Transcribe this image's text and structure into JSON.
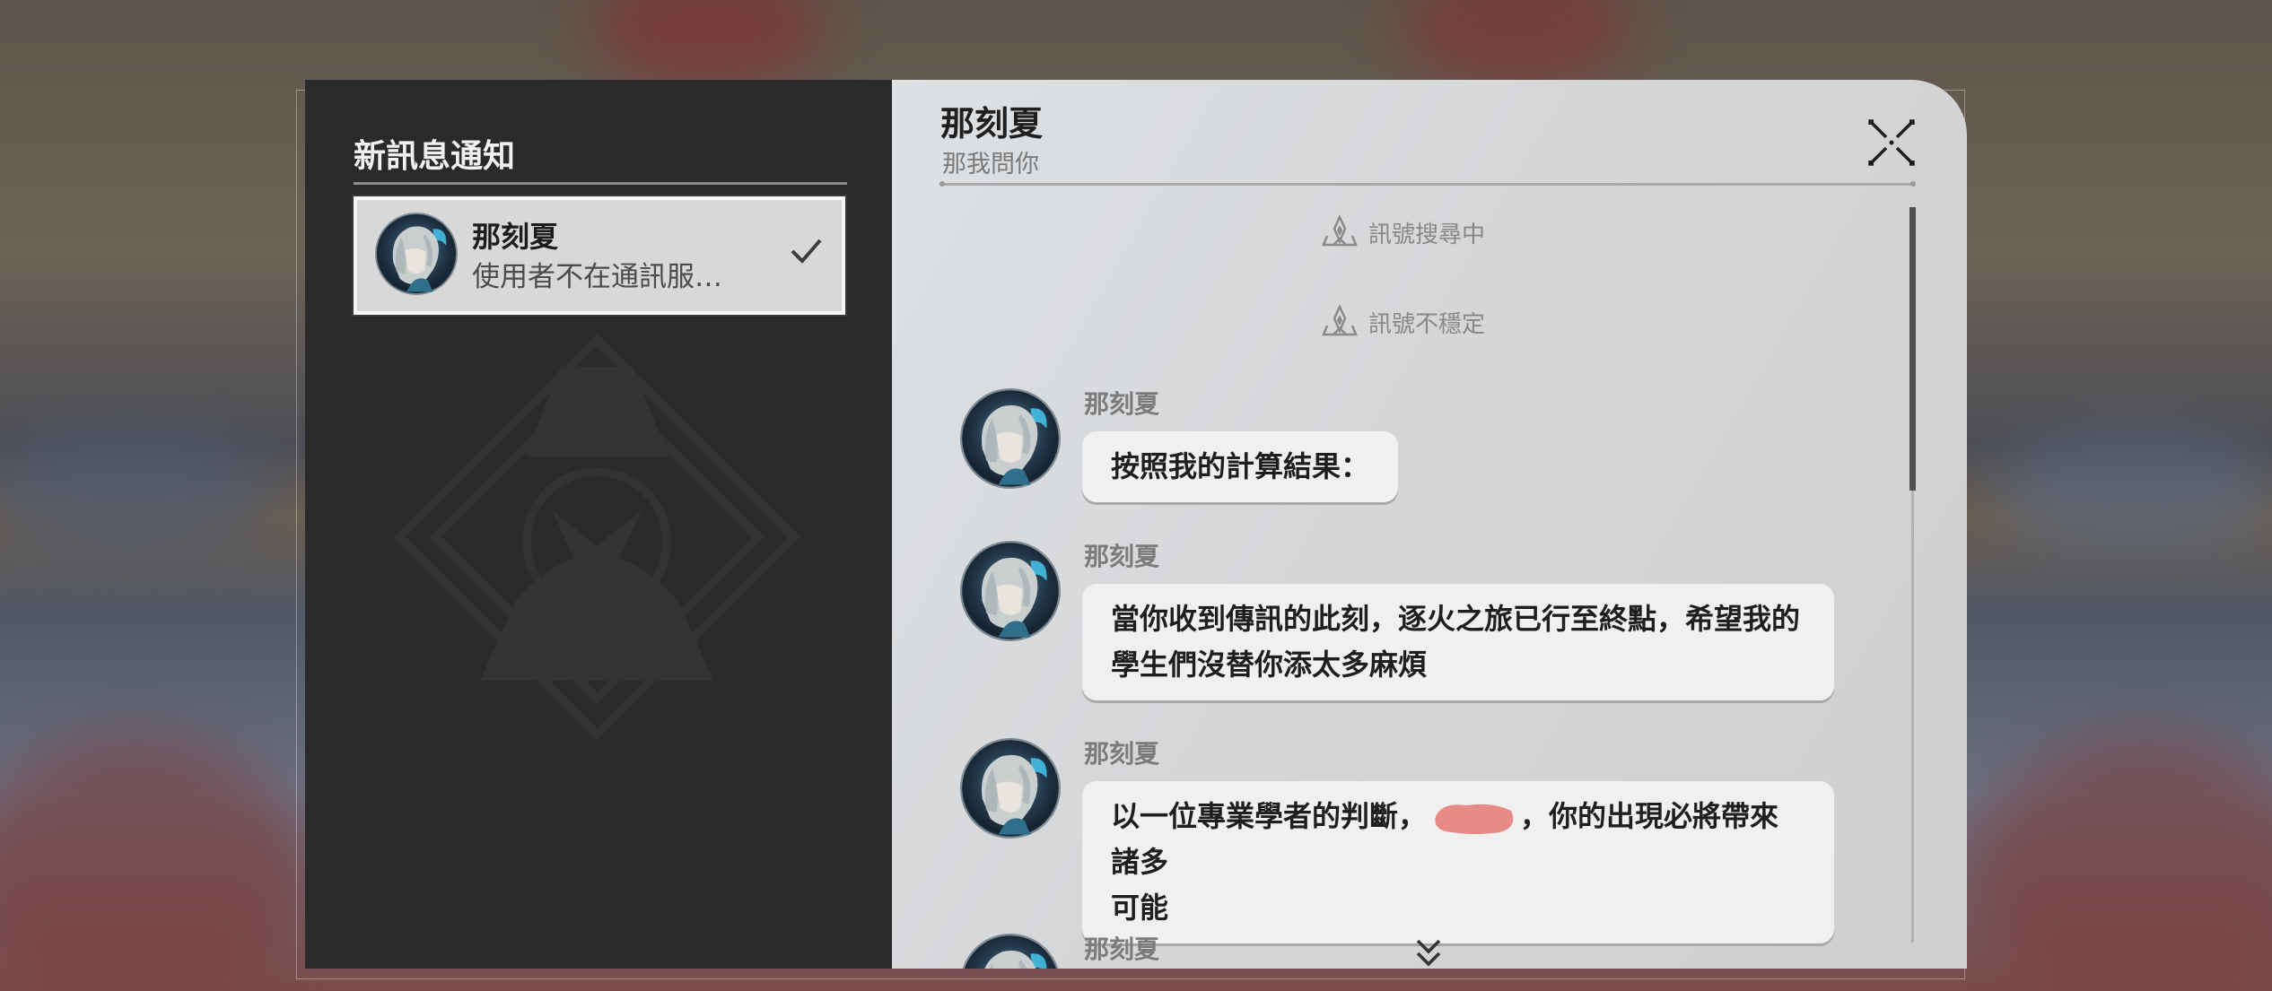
{
  "notifications": {
    "title": "新訊息通知",
    "items": [
      {
        "name": "那刻夏",
        "preview": "使用者不在通訊服…",
        "read": true
      }
    ]
  },
  "chat": {
    "title": "那刻夏",
    "subtitle": "那我問你",
    "system_messages": [
      "訊號搜尋中",
      "訊號不穩定"
    ],
    "messages": [
      {
        "sender": "那刻夏",
        "text": "按照我的計算結果："
      },
      {
        "sender": "那刻夏",
        "line1": "當你收到傳訊的此刻，逐火之旅已行至終點，希望我的",
        "line2": "學生們沒替你添太多麻煩"
      },
      {
        "sender": "那刻夏",
        "line1_before": "以一位專業學者的判斷，",
        "line1_after": "，你的出現必將帶來諸多",
        "line2": "可能"
      },
      {
        "sender": "那刻夏"
      }
    ]
  },
  "icons": {
    "close": "close-x-icon",
    "check": "checkmark-icon",
    "signal": "signal-beacon-icon",
    "more": "double-chevron-down-icon"
  },
  "colors": {
    "left_panel": "#2a2a2a",
    "selected_item": "#d8d8d8",
    "bubble": "#f0f0f0",
    "redaction": "#e88a85"
  }
}
